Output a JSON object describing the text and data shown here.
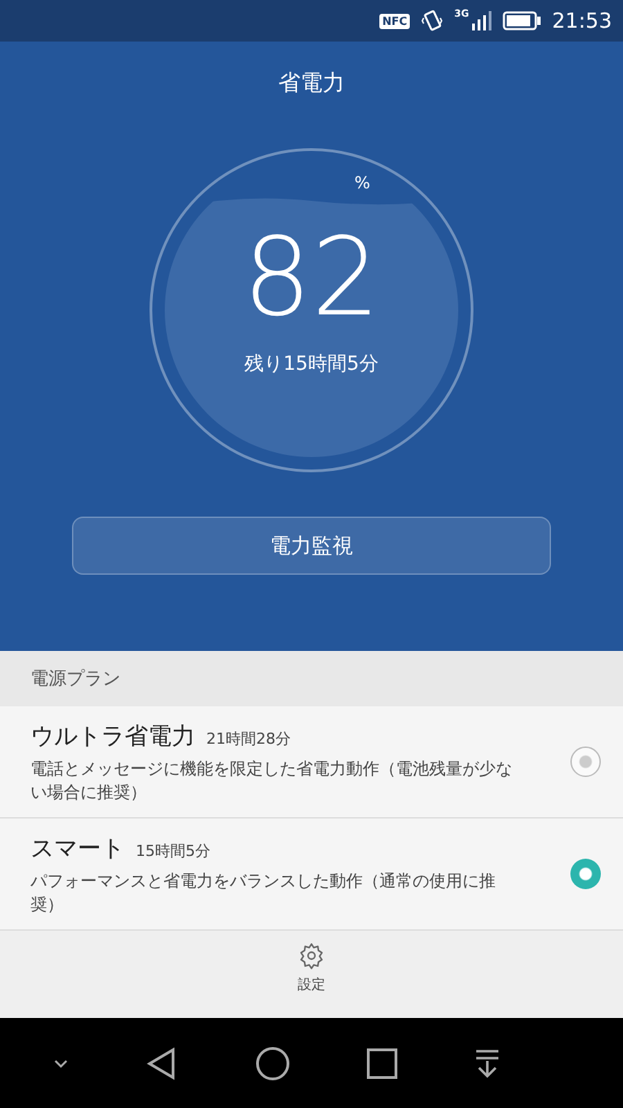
{
  "status_bar": {
    "nfc": "NFC",
    "network": "3G",
    "time": "21:53"
  },
  "title": "省電力",
  "battery": {
    "percent": "82",
    "unit": "%",
    "remaining": "残り15時間5分"
  },
  "monitor_button": "電力監視",
  "plans": {
    "header": "電源プラン",
    "items": [
      {
        "name": "ウルトラ省電力",
        "time": "21時間28分",
        "description": "電話とメッセージに機能を限定した省電力動作（電池残量が少ない場合に推奨）",
        "selected": false
      },
      {
        "name": "スマート",
        "time": "15時間5分",
        "description": "パフォーマンスと省電力をバランスした動作（通常の使用に推奨）",
        "selected": true
      }
    ]
  },
  "settings": "設定"
}
